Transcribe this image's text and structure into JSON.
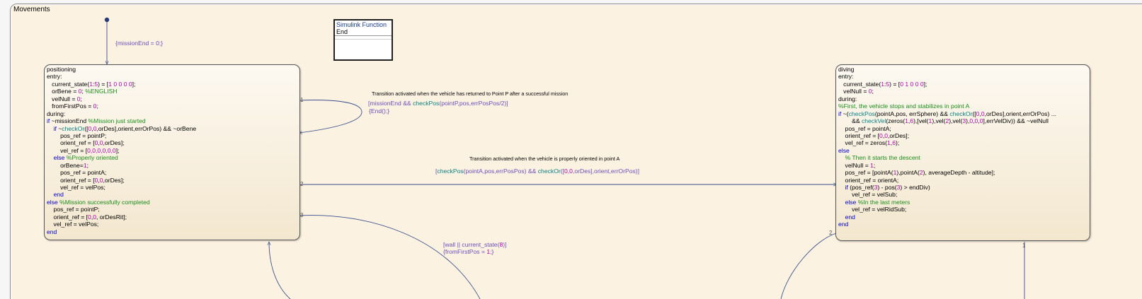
{
  "chart": {
    "title": "Movements"
  },
  "simulink_function": {
    "header": "Simulink Function",
    "name": "End"
  },
  "default_transition": {
    "action": "{missionEnd = 0;}"
  },
  "states": {
    "positioning": {
      "lines": [
        [
          {
            "t": "positioning"
          }
        ],
        [
          {
            "t": "entry:"
          }
        ],
        [
          {
            "t": "   current_state("
          },
          {
            "t": "1",
            "c": "n"
          },
          {
            "t": ":"
          },
          {
            "t": "5",
            "c": "n"
          },
          {
            "t": ") = ["
          },
          {
            "t": "1 0 0 0 0",
            "c": "n"
          },
          {
            "t": "];"
          }
        ],
        [
          {
            "t": "   orBene = "
          },
          {
            "t": "0",
            "c": "n"
          },
          {
            "t": "; "
          },
          {
            "t": "%ENGLISH",
            "c": "c"
          }
        ],
        [
          {
            "t": "   velNull = "
          },
          {
            "t": "0",
            "c": "n"
          },
          {
            "t": ";"
          }
        ],
        [
          {
            "t": "   fromFirstPos = "
          },
          {
            "t": "0",
            "c": "n"
          },
          {
            "t": ";"
          }
        ],
        [
          {
            "t": "during:"
          }
        ],
        [
          {
            "t": "if",
            "c": "k"
          },
          {
            "t": " ~missionEnd "
          },
          {
            "t": "%Mission just started",
            "c": "c"
          }
        ],
        [
          {
            "t": "    "
          },
          {
            "t": "if",
            "c": "k"
          },
          {
            "t": " ~"
          },
          {
            "t": "checkOr",
            "c": "f"
          },
          {
            "t": "(["
          },
          {
            "t": "0",
            "c": "n"
          },
          {
            "t": ","
          },
          {
            "t": "0",
            "c": "n"
          },
          {
            "t": ",orDes],orient,errOrPos) && ~orBene"
          }
        ],
        [
          {
            "t": "        pos_ref = pointP;"
          }
        ],
        [
          {
            "t": "        orient_ref = ["
          },
          {
            "t": "0",
            "c": "n"
          },
          {
            "t": ","
          },
          {
            "t": "0",
            "c": "n"
          },
          {
            "t": ",orDes];"
          }
        ],
        [
          {
            "t": "        vel_ref = ["
          },
          {
            "t": "0,0,0,0,0,0",
            "c": "n"
          },
          {
            "t": "];"
          }
        ],
        [
          {
            "t": "    "
          },
          {
            "t": "else",
            "c": "k"
          },
          {
            "t": " "
          },
          {
            "t": "%Properly oriented",
            "c": "c"
          }
        ],
        [
          {
            "t": "        orBene="
          },
          {
            "t": "1",
            "c": "n"
          },
          {
            "t": ";"
          }
        ],
        [
          {
            "t": "        pos_ref = pointA;"
          }
        ],
        [
          {
            "t": "        orient_ref = ["
          },
          {
            "t": "0",
            "c": "n"
          },
          {
            "t": ","
          },
          {
            "t": "0",
            "c": "n"
          },
          {
            "t": ",orDes];"
          }
        ],
        [
          {
            "t": "        vel_ref = velPos;"
          }
        ],
        [
          {
            "t": "    "
          },
          {
            "t": "end",
            "c": "k"
          }
        ],
        [
          {
            "t": "else",
            "c": "k"
          },
          {
            "t": " "
          },
          {
            "t": "%Mission successfully completed",
            "c": "c"
          }
        ],
        [
          {
            "t": "    pos_ref = pointP;"
          }
        ],
        [
          {
            "t": "    orient_ref = ["
          },
          {
            "t": "0",
            "c": "n"
          },
          {
            "t": ","
          },
          {
            "t": "0",
            "c": "n"
          },
          {
            "t": ", orDesRit];"
          }
        ],
        [
          {
            "t": "    vel_ref = velPos;"
          }
        ],
        [
          {
            "t": "end",
            "c": "k"
          }
        ]
      ]
    },
    "diving": {
      "lines": [
        [
          {
            "t": "diving"
          }
        ],
        [
          {
            "t": "entry:"
          }
        ],
        [
          {
            "t": "   current_state("
          },
          {
            "t": "1",
            "c": "n"
          },
          {
            "t": ":"
          },
          {
            "t": "5",
            "c": "n"
          },
          {
            "t": ") = ["
          },
          {
            "t": "0 1 0 0 0",
            "c": "n"
          },
          {
            "t": "];"
          }
        ],
        [
          {
            "t": "   velNull = "
          },
          {
            "t": "0",
            "c": "n"
          },
          {
            "t": ";"
          }
        ],
        [
          {
            "t": "during:"
          }
        ],
        [
          {
            "t": "%First, the vehicle stops and stabilizes in point A",
            "c": "c"
          }
        ],
        [
          {
            "t": "if",
            "c": "k"
          },
          {
            "t": " ~("
          },
          {
            "t": "checkPos",
            "c": "f"
          },
          {
            "t": "(pointA,pos, errSphere) && "
          },
          {
            "t": "checkOr",
            "c": "f"
          },
          {
            "t": "(["
          },
          {
            "t": "0",
            "c": "n"
          },
          {
            "t": ","
          },
          {
            "t": "0",
            "c": "n"
          },
          {
            "t": ",orDes],orient,errOrPos) ..."
          }
        ],
        [
          {
            "t": "        && "
          },
          {
            "t": "checkVel",
            "c": "f"
          },
          {
            "t": "(zeros("
          },
          {
            "t": "1",
            "c": "n"
          },
          {
            "t": ","
          },
          {
            "t": "6",
            "c": "n"
          },
          {
            "t": "),[vel("
          },
          {
            "t": "1",
            "c": "n"
          },
          {
            "t": "),vel("
          },
          {
            "t": "2",
            "c": "n"
          },
          {
            "t": "),vel("
          },
          {
            "t": "3",
            "c": "n"
          },
          {
            "t": "),"
          },
          {
            "t": "0",
            "c": "n"
          },
          {
            "t": ","
          },
          {
            "t": "0",
            "c": "n"
          },
          {
            "t": ","
          },
          {
            "t": "0",
            "c": "n"
          },
          {
            "t": "],errVelDiv)) && ~velNull"
          }
        ],
        [
          {
            "t": "    pos_ref = pointA;"
          }
        ],
        [
          {
            "t": "    orient_ref = ["
          },
          {
            "t": "0",
            "c": "n"
          },
          {
            "t": ","
          },
          {
            "t": "0",
            "c": "n"
          },
          {
            "t": ",orDes];"
          }
        ],
        [
          {
            "t": "    vel_ref = zeros("
          },
          {
            "t": "1",
            "c": "n"
          },
          {
            "t": ","
          },
          {
            "t": "6",
            "c": "n"
          },
          {
            "t": ");"
          }
        ],
        [
          {
            "t": "else",
            "c": "k"
          }
        ],
        [
          {
            "t": "    "
          },
          {
            "t": "% Then it starts the descent",
            "c": "c"
          }
        ],
        [
          {
            "t": "    velNull = "
          },
          {
            "t": "1",
            "c": "n"
          },
          {
            "t": ";"
          }
        ],
        [
          {
            "t": "    pos_ref = [pointA("
          },
          {
            "t": "1",
            "c": "n"
          },
          {
            "t": "),pointA("
          },
          {
            "t": "2",
            "c": "n"
          },
          {
            "t": "), averageDepth - altitude];"
          }
        ],
        [
          {
            "t": "    orient_ref = orientA;"
          }
        ],
        [
          {
            "t": "    "
          },
          {
            "t": "if",
            "c": "k"
          },
          {
            "t": " (pos_ref("
          },
          {
            "t": "3",
            "c": "n"
          },
          {
            "t": ") - pos("
          },
          {
            "t": "3",
            "c": "n"
          },
          {
            "t": ") > endDiv)"
          }
        ],
        [
          {
            "t": "        vel_ref = velSub;"
          }
        ],
        [
          {
            "t": "    "
          },
          {
            "t": "else",
            "c": "k"
          },
          {
            "t": " "
          },
          {
            "t": "%In the last meters",
            "c": "c"
          }
        ],
        [
          {
            "t": "        vel_ref = velRidSub;"
          }
        ],
        [
          {
            "t": "    "
          },
          {
            "t": "end",
            "c": "k"
          }
        ],
        [
          {
            "t": "end",
            "c": "k"
          }
        ]
      ]
    }
  },
  "transitions": {
    "self_loop": {
      "note": "Transition activated when the vehicle has returned to Point P after a successful mission",
      "condition": [
        {
          "t": "[missionEnd && "
        },
        {
          "t": "checkPos",
          "c": "f"
        },
        {
          "t": "(pointP,pos,errPosPos/2)]"
        }
      ],
      "action": [
        {
          "t": "{End();}"
        }
      ],
      "order": "1"
    },
    "to_diving": {
      "note": "Transition activated when the vehicle is properly oriented in point A",
      "condition": [
        {
          "t": "["
        },
        {
          "t": "checkPos",
          "c": "f"
        },
        {
          "t": "(pointA,pos,errPosPos) && "
        },
        {
          "t": "checkOr",
          "c": "f"
        },
        {
          "t": "(["
        },
        {
          "t": "0",
          "c": "n"
        },
        {
          "t": ","
        },
        {
          "t": "0",
          "c": "n"
        },
        {
          "t": ",orDes],orient,errOrPos)]"
        }
      ],
      "order": "2"
    },
    "down_3": {
      "condition": [
        {
          "t": "[wall || current_state("
        },
        {
          "t": "8",
          "c": "n"
        },
        {
          "t": ")]"
        }
      ],
      "action": [
        {
          "t": "{fromFirstPos = "
        },
        {
          "t": "1",
          "c": "n"
        },
        {
          "t": ";}"
        }
      ],
      "order": "3"
    },
    "diving_out_1": {
      "order": "1"
    },
    "diving_out_2": {
      "order": "2"
    }
  },
  "colors": {
    "keyword": "#0000c8",
    "function": "#0a7f80",
    "number": "#b000b0",
    "comment": "#1b8c1b",
    "transition_label": "#6a4fb8",
    "chart_background": "#fcf2e2"
  }
}
